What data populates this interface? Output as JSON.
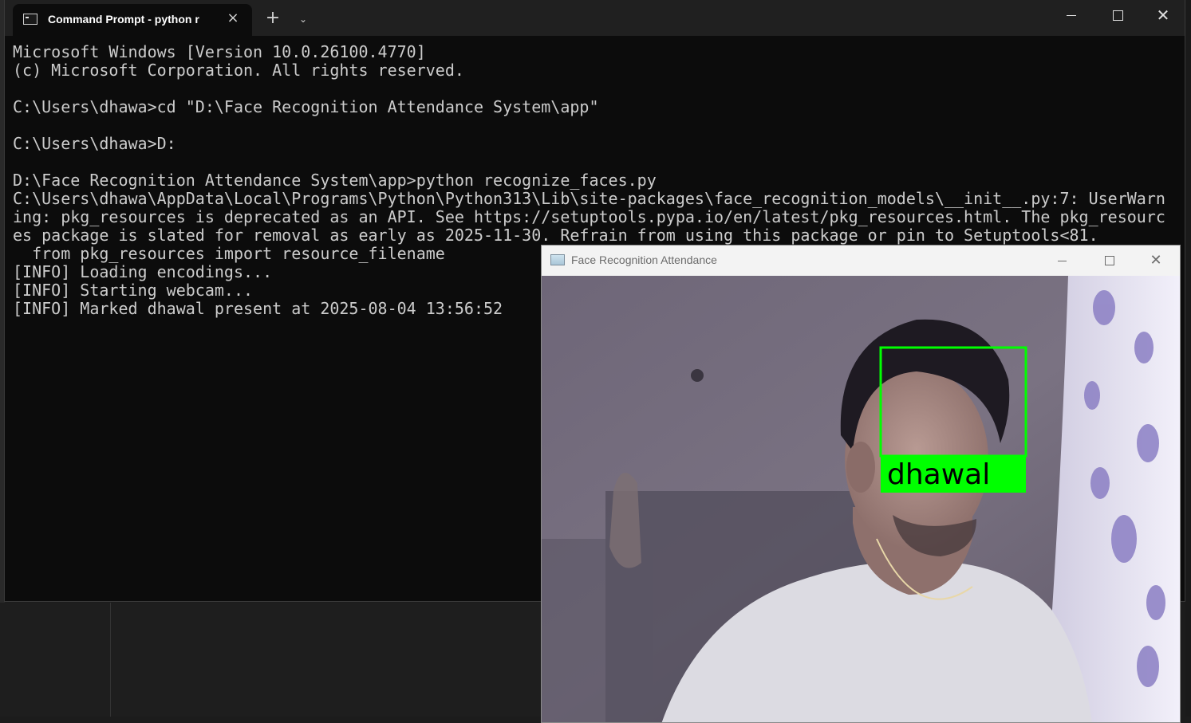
{
  "terminal": {
    "tab_title": "Command Prompt - python r",
    "lines": [
      "Microsoft Windows [Version 10.0.26100.4770]",
      "(c) Microsoft Corporation. All rights reserved.",
      "",
      "C:\\Users\\dhawa>cd \"D:\\Face Recognition Attendance System\\app\"",
      "",
      "C:\\Users\\dhawa>D:",
      "",
      "D:\\Face Recognition Attendance System\\app>python recognize_faces.py",
      "C:\\Users\\dhawa\\AppData\\Local\\Programs\\Python\\Python313\\Lib\\site-packages\\face_recognition_models\\__init__.py:7: UserWarn",
      "ing: pkg_resources is deprecated as an API. See https://setuptools.pypa.io/en/latest/pkg_resources.html. The pkg_resourc",
      "es package is slated for removal as early as 2025-11-30. Refrain from using this package or pin to Setuptools<81.",
      "  from pkg_resources import resource_filename",
      "[INFO] Loading encodings...",
      "[INFO] Starting webcam...",
      "[INFO] Marked dhawal present at 2025-08-04 13:56:52"
    ]
  },
  "camera_window": {
    "title": "Face Recognition Attendance",
    "detected_name": "dhawal",
    "box_color": "#00ff00"
  }
}
